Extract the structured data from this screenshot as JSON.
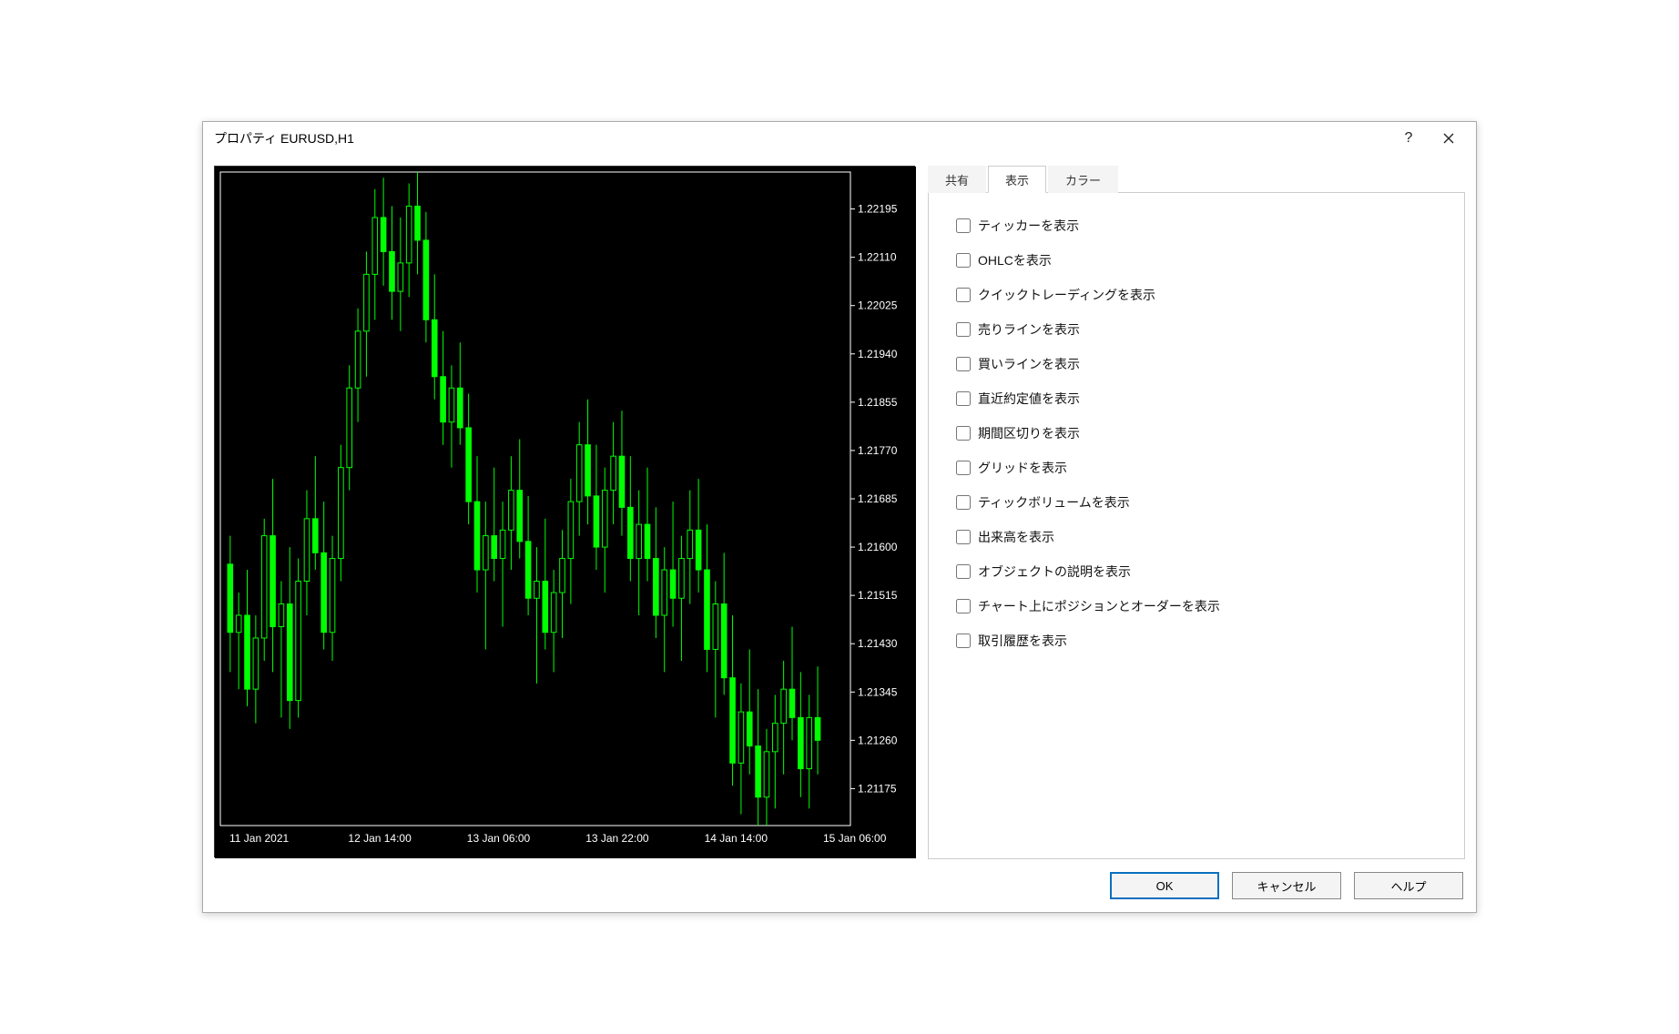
{
  "title": "プロパティ EURUSD,H1",
  "tabs": [
    {
      "label": "共有"
    },
    {
      "label": "表示",
      "active": true
    },
    {
      "label": "カラー"
    }
  ],
  "options": [
    {
      "label": "ティッカーを表示",
      "checked": false
    },
    {
      "label": "OHLCを表示",
      "checked": false
    },
    {
      "label": "クイックトレーディングを表示",
      "checked": false
    },
    {
      "label": "売りラインを表示",
      "checked": false
    },
    {
      "label": "買いラインを表示",
      "checked": false
    },
    {
      "label": "直近約定値を表示",
      "checked": false
    },
    {
      "label": "期間区切りを表示",
      "checked": false
    },
    {
      "label": "グリッドを表示",
      "checked": false
    },
    {
      "label": "ティックボリュームを表示",
      "checked": false
    },
    {
      "label": "出来高を表示",
      "checked": false
    },
    {
      "label": "オブジェクトの説明を表示",
      "checked": false
    },
    {
      "label": "チャート上にポジションとオーダーを表示",
      "checked": false
    },
    {
      "label": "取引履歴を表示",
      "checked": false
    }
  ],
  "buttons": {
    "ok": "OK",
    "cancel": "キャンセル",
    "help": "ヘルプ"
  },
  "chart_data": {
    "type": "candlestick",
    "symbol": "EURUSD",
    "timeframe": "H1",
    "ylabel": "",
    "xlabel": "",
    "y_ticks": [
      1.22195,
      1.2211,
      1.22025,
      1.2194,
      1.21855,
      1.2177,
      1.21685,
      1.216,
      1.21515,
      1.2143,
      1.21345,
      1.2126,
      1.21175
    ],
    "x_ticks": [
      "11 Jan 2021",
      "12 Jan 14:00",
      "13 Jan 06:00",
      "13 Jan 22:00",
      "14 Jan 14:00",
      "15 Jan 06:00"
    ],
    "ylim": [
      1.2111,
      1.2226
    ],
    "colors": {
      "up": "#00ff00",
      "down": "#000000",
      "outline": "#00ff00",
      "wick": "#00ff00",
      "bg": "#000000",
      "axis": "#ffffff"
    },
    "candles": [
      {
        "o": 1.2157,
        "h": 1.2162,
        "l": 1.2138,
        "c": 1.2145
      },
      {
        "o": 1.2145,
        "h": 1.2152,
        "l": 1.2135,
        "c": 1.2148
      },
      {
        "o": 1.2148,
        "h": 1.2156,
        "l": 1.2132,
        "c": 1.2135
      },
      {
        "o": 1.2135,
        "h": 1.2148,
        "l": 1.2129,
        "c": 1.2144
      },
      {
        "o": 1.2144,
        "h": 1.2165,
        "l": 1.214,
        "c": 1.2162
      },
      {
        "o": 1.2162,
        "h": 1.2172,
        "l": 1.2138,
        "c": 1.2146
      },
      {
        "o": 1.2146,
        "h": 1.2154,
        "l": 1.213,
        "c": 1.215
      },
      {
        "o": 1.215,
        "h": 1.216,
        "l": 1.2128,
        "c": 1.2133
      },
      {
        "o": 1.2133,
        "h": 1.2158,
        "l": 1.213,
        "c": 1.2154
      },
      {
        "o": 1.2154,
        "h": 1.217,
        "l": 1.2148,
        "c": 1.2165
      },
      {
        "o": 1.2165,
        "h": 1.2176,
        "l": 1.2156,
        "c": 1.2159
      },
      {
        "o": 1.2159,
        "h": 1.2168,
        "l": 1.2142,
        "c": 1.2145
      },
      {
        "o": 1.2145,
        "h": 1.2162,
        "l": 1.214,
        "c": 1.2158
      },
      {
        "o": 1.2158,
        "h": 1.2178,
        "l": 1.2154,
        "c": 1.2174
      },
      {
        "o": 1.2174,
        "h": 1.2192,
        "l": 1.217,
        "c": 1.2188
      },
      {
        "o": 1.2188,
        "h": 1.2202,
        "l": 1.2182,
        "c": 1.2198
      },
      {
        "o": 1.2198,
        "h": 1.2212,
        "l": 1.219,
        "c": 1.2208
      },
      {
        "o": 1.2208,
        "h": 1.2223,
        "l": 1.22,
        "c": 1.2218
      },
      {
        "o": 1.2218,
        "h": 1.2225,
        "l": 1.2206,
        "c": 1.2212
      },
      {
        "o": 1.2212,
        "h": 1.222,
        "l": 1.22,
        "c": 1.2205
      },
      {
        "o": 1.2205,
        "h": 1.2218,
        "l": 1.2198,
        "c": 1.221
      },
      {
        "o": 1.221,
        "h": 1.2224,
        "l": 1.2204,
        "c": 1.222
      },
      {
        "o": 1.222,
        "h": 1.2226,
        "l": 1.2208,
        "c": 1.2214
      },
      {
        "o": 1.2214,
        "h": 1.2219,
        "l": 1.2196,
        "c": 1.22
      },
      {
        "o": 1.22,
        "h": 1.2208,
        "l": 1.2186,
        "c": 1.219
      },
      {
        "o": 1.219,
        "h": 1.2198,
        "l": 1.2178,
        "c": 1.2182
      },
      {
        "o": 1.2182,
        "h": 1.2192,
        "l": 1.2174,
        "c": 1.2188
      },
      {
        "o": 1.2188,
        "h": 1.2196,
        "l": 1.2178,
        "c": 1.2181
      },
      {
        "o": 1.2181,
        "h": 1.2187,
        "l": 1.2164,
        "c": 1.2168
      },
      {
        "o": 1.2168,
        "h": 1.2176,
        "l": 1.2152,
        "c": 1.2156
      },
      {
        "o": 1.2156,
        "h": 1.2168,
        "l": 1.2142,
        "c": 1.2162
      },
      {
        "o": 1.2162,
        "h": 1.2174,
        "l": 1.2154,
        "c": 1.2158
      },
      {
        "o": 1.2158,
        "h": 1.2168,
        "l": 1.2146,
        "c": 1.2163
      },
      {
        "o": 1.2163,
        "h": 1.2176,
        "l": 1.2156,
        "c": 1.217
      },
      {
        "o": 1.217,
        "h": 1.2179,
        "l": 1.2158,
        "c": 1.2161
      },
      {
        "o": 1.2161,
        "h": 1.2169,
        "l": 1.2148,
        "c": 1.2151
      },
      {
        "o": 1.2151,
        "h": 1.216,
        "l": 1.2136,
        "c": 1.2154
      },
      {
        "o": 1.2154,
        "h": 1.2165,
        "l": 1.2142,
        "c": 1.2145
      },
      {
        "o": 1.2145,
        "h": 1.2156,
        "l": 1.2138,
        "c": 1.2152
      },
      {
        "o": 1.2152,
        "h": 1.2163,
        "l": 1.2144,
        "c": 1.2158
      },
      {
        "o": 1.2158,
        "h": 1.2172,
        "l": 1.215,
        "c": 1.2168
      },
      {
        "o": 1.2168,
        "h": 1.2182,
        "l": 1.2162,
        "c": 1.2178
      },
      {
        "o": 1.2178,
        "h": 1.2186,
        "l": 1.2164,
        "c": 1.2169
      },
      {
        "o": 1.2169,
        "h": 1.2178,
        "l": 1.2156,
        "c": 1.216
      },
      {
        "o": 1.216,
        "h": 1.2174,
        "l": 1.2152,
        "c": 1.217
      },
      {
        "o": 1.217,
        "h": 1.2182,
        "l": 1.2164,
        "c": 1.2176
      },
      {
        "o": 1.2176,
        "h": 1.2184,
        "l": 1.2162,
        "c": 1.2167
      },
      {
        "o": 1.2167,
        "h": 1.2176,
        "l": 1.2154,
        "c": 1.2158
      },
      {
        "o": 1.2158,
        "h": 1.217,
        "l": 1.2148,
        "c": 1.2164
      },
      {
        "o": 1.2164,
        "h": 1.2174,
        "l": 1.2154,
        "c": 1.2158
      },
      {
        "o": 1.2158,
        "h": 1.2167,
        "l": 1.2144,
        "c": 1.2148
      },
      {
        "o": 1.2148,
        "h": 1.216,
        "l": 1.2138,
        "c": 1.2156
      },
      {
        "o": 1.2156,
        "h": 1.2168,
        "l": 1.2146,
        "c": 1.2151
      },
      {
        "o": 1.2151,
        "h": 1.2162,
        "l": 1.214,
        "c": 1.2158
      },
      {
        "o": 1.2158,
        "h": 1.217,
        "l": 1.215,
        "c": 1.2163
      },
      {
        "o": 1.2163,
        "h": 1.2172,
        "l": 1.2152,
        "c": 1.2156
      },
      {
        "o": 1.2156,
        "h": 1.2164,
        "l": 1.2138,
        "c": 1.2142
      },
      {
        "o": 1.2142,
        "h": 1.2154,
        "l": 1.213,
        "c": 1.215
      },
      {
        "o": 1.215,
        "h": 1.2159,
        "l": 1.2134,
        "c": 1.2137
      },
      {
        "o": 1.2137,
        "h": 1.2148,
        "l": 1.2118,
        "c": 1.2122
      },
      {
        "o": 1.2122,
        "h": 1.2136,
        "l": 1.2113,
        "c": 1.2131
      },
      {
        "o": 1.2131,
        "h": 1.2142,
        "l": 1.212,
        "c": 1.2125
      },
      {
        "o": 1.2125,
        "h": 1.2135,
        "l": 1.2111,
        "c": 1.2116
      },
      {
        "o": 1.2116,
        "h": 1.2128,
        "l": 1.2111,
        "c": 1.2124
      },
      {
        "o": 1.2124,
        "h": 1.2134,
        "l": 1.2114,
        "c": 1.2129
      },
      {
        "o": 1.2129,
        "h": 1.214,
        "l": 1.212,
        "c": 1.2135
      },
      {
        "o": 1.2135,
        "h": 1.2146,
        "l": 1.2126,
        "c": 1.213
      },
      {
        "o": 1.213,
        "h": 1.2138,
        "l": 1.2116,
        "c": 1.2121
      },
      {
        "o": 1.2121,
        "h": 1.2134,
        "l": 1.2114,
        "c": 1.213
      },
      {
        "o": 1.213,
        "h": 1.2139,
        "l": 1.212,
        "c": 1.2126
      }
    ]
  }
}
